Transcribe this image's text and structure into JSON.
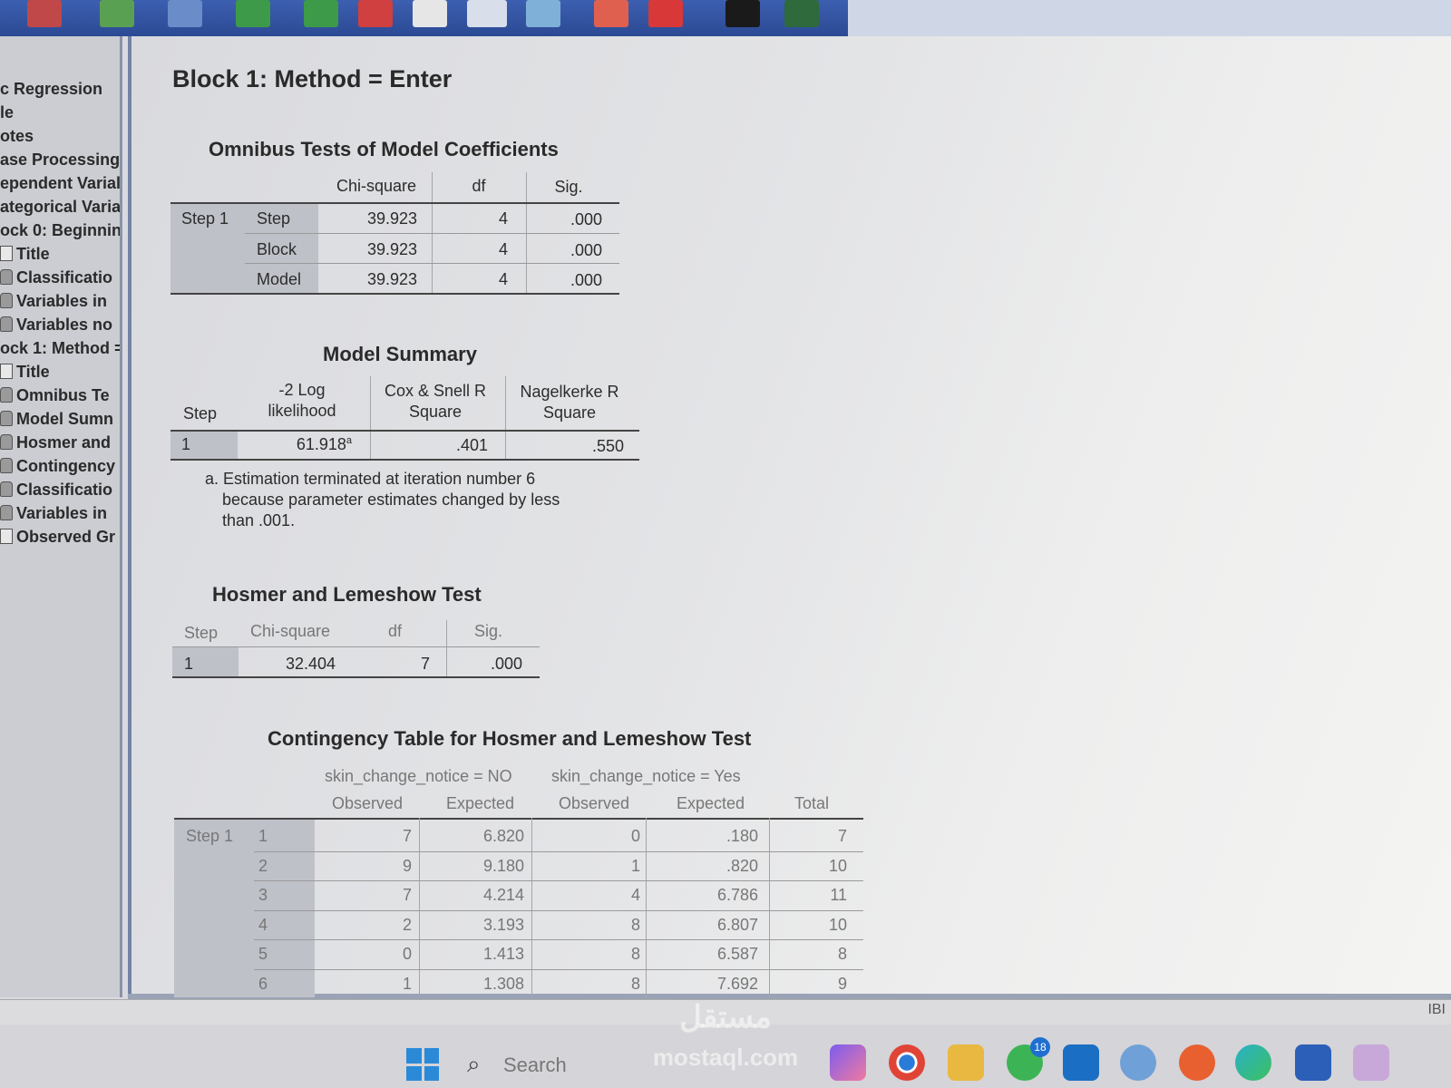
{
  "outline": {
    "items": [
      "c Regression",
      "le",
      "otes",
      "ase Processing",
      "ependent Varial",
      "ategorical Varia",
      "ock 0: Beginnin",
      "Title",
      "Classificatio",
      "Variables in",
      "Variables no",
      "ock 1: Method =",
      "Title",
      "Omnibus Te",
      "Model Sumn",
      "Hosmer and",
      "Contingency",
      "Classificatio",
      "Variables in",
      "Observed Gr"
    ]
  },
  "block_title": "Block 1: Method = Enter",
  "omnibus": {
    "title": "Omnibus Tests of Model Coefficients",
    "headers": [
      "Chi-square",
      "df",
      "Sig."
    ],
    "group": "Step 1",
    "rows": [
      {
        "label": "Step",
        "chi": "39.923",
        "df": "4",
        "sig": ".000"
      },
      {
        "label": "Block",
        "chi": "39.923",
        "df": "4",
        "sig": ".000"
      },
      {
        "label": "Model",
        "chi": "39.923",
        "df": "4",
        "sig": ".000"
      }
    ]
  },
  "model_summary": {
    "title": "Model Summary",
    "step_header": "Step",
    "h1a": "-2 Log",
    "h1b": "likelihood",
    "h2a": "Cox & Snell R",
    "h2b": "Square",
    "h3a": "Nagelkerke R",
    "h3b": "Square",
    "row": {
      "step": "1",
      "ll": "61.918",
      "ll_sup": "a",
      "cs": ".401",
      "nk": ".550"
    },
    "footnote_1": "a. Estimation terminated at iteration number 6",
    "footnote_2": "because parameter estimates changed by less",
    "footnote_3": "than .001."
  },
  "hosmer": {
    "title": "Hosmer and Lemeshow Test",
    "headers": [
      "Step",
      "Chi-square",
      "df",
      "Sig."
    ],
    "row": {
      "step": "1",
      "chi": "32.404",
      "df": "7",
      "sig": ".000"
    }
  },
  "contingency": {
    "title": "Contingency Table for Hosmer and Lemeshow Test",
    "group_no": "skin_change_notice = NO",
    "group_yes": "skin_change_notice = Yes",
    "sub_headers": [
      "Observed",
      "Expected",
      "Observed",
      "Expected",
      "Total"
    ],
    "group": "Step 1",
    "rows": [
      {
        "n": "1",
        "o1": "7",
        "e1": "6.820",
        "o2": "0",
        "e2": ".180",
        "t": "7"
      },
      {
        "n": "2",
        "o1": "9",
        "e1": "9.180",
        "o2": "1",
        "e2": ".820",
        "t": "10"
      },
      {
        "n": "3",
        "o1": "7",
        "e1": "4.214",
        "o2": "4",
        "e2": "6.786",
        "t": "11"
      },
      {
        "n": "4",
        "o1": "2",
        "e1": "3.193",
        "o2": "8",
        "e2": "6.807",
        "t": "10"
      },
      {
        "n": "5",
        "o1": "0",
        "e1": "1.413",
        "o2": "8",
        "e2": "6.587",
        "t": "8"
      },
      {
        "n": "6",
        "o1": "1",
        "e1": "1.308",
        "o2": "8",
        "e2": "7.692",
        "t": "9"
      }
    ]
  },
  "status": {
    "right_text": "IBI"
  },
  "taskbar": {
    "search_placeholder": "Search",
    "badge_count": "18",
    "watermark_1": "مستقل",
    "watermark_2": "mostaql.com"
  },
  "colors": {
    "toolbar": "#2b4a94",
    "shade": "#bfc1c9",
    "outline_bg": "#cbcdd2"
  }
}
